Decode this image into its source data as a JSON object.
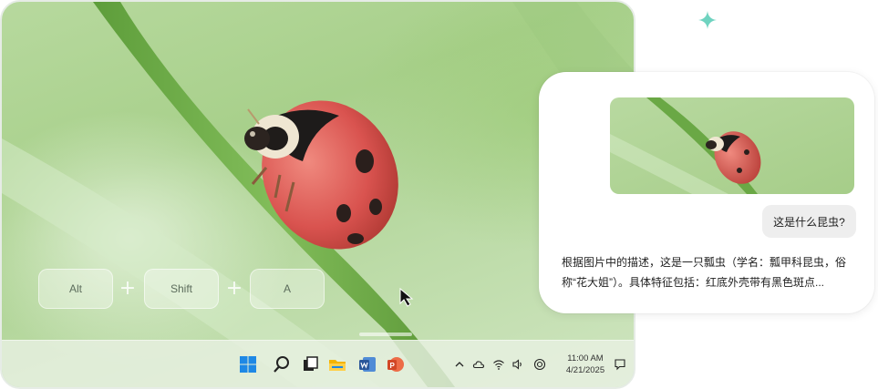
{
  "shortcut": {
    "keys": [
      "Alt",
      "Shift",
      "A"
    ],
    "separator": "+"
  },
  "taskbar": {
    "apps": [
      "start-icon",
      "search-icon",
      "task-view-icon",
      "file-explorer-icon",
      "word-icon",
      "powerpoint-icon"
    ],
    "tray": [
      "chevron-up-icon",
      "cloud-icon",
      "wifi-icon",
      "volume-icon",
      "language-icon",
      "notification-icon"
    ],
    "time": "11:00 AM",
    "date": "4/21/2025"
  },
  "chat": {
    "image_alt": "ladybug",
    "question": "这是什么昆虫?",
    "answer": "根据图片中的描述，这是一只瓢虫（学名：瓢甲科昆虫，俗称“花大姐”）。具体特征包括：红底外壳带有黑色斑点..."
  },
  "colors": {
    "accent_sparkle": "#6fd3c0",
    "ladybug_red": "#d9534f",
    "grass_green": "#5aa33a",
    "word_blue": "#2b579a",
    "powerpoint_orange": "#d24726"
  }
}
